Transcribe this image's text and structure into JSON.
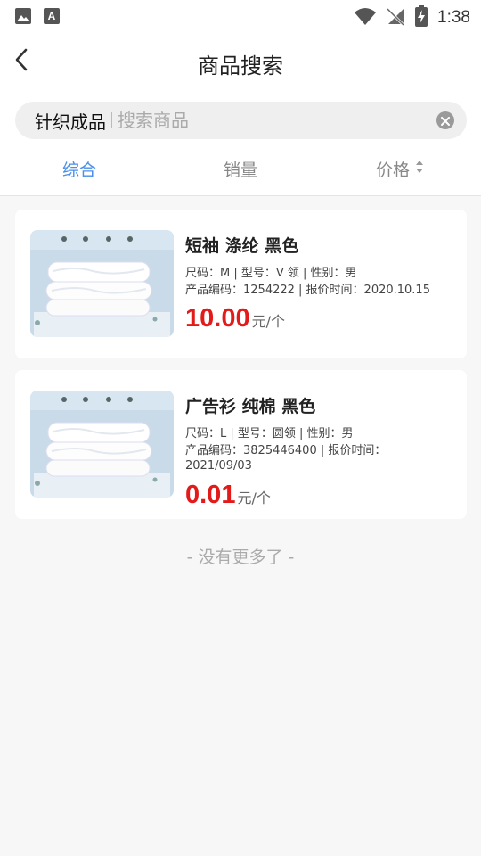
{
  "status_bar": {
    "time": "1:38",
    "icons": [
      "image-icon",
      "font-icon",
      "wifi-icon",
      "no-signal-icon",
      "battery-charging-icon"
    ]
  },
  "header": {
    "title": "商品搜索",
    "back_icon": "chevron-left-icon"
  },
  "search": {
    "value": "针织成品",
    "placeholder": "搜索商品",
    "clear_icon": "clear-icon"
  },
  "tabs": [
    {
      "label": "综合",
      "active": true
    },
    {
      "label": "销量",
      "active": false
    },
    {
      "label": "价格",
      "active": false,
      "sort_icon": "sort-icon"
    }
  ],
  "accent_color": "#4a8fe8",
  "price_color": "#e31a1a",
  "products": [
    {
      "name": "短袖  涤纶 黑色",
      "spec": "尺码：M | 型号：V 领 | 性别：男",
      "code_line": "产品编码：1254222 | 报价时间：2020.10.15",
      "price": "10.00",
      "unit": "元/个"
    },
    {
      "name": "广告衫  纯棉 黑色",
      "spec": "尺码：L | 型号：圆领 | 性别：男",
      "code_line": "产品编码：3825446400 | 报价时间：",
      "date_line": "2021/09/03",
      "price": "0.01",
      "unit": "元/个"
    }
  ],
  "footer_text": "- 没有更多了 -"
}
